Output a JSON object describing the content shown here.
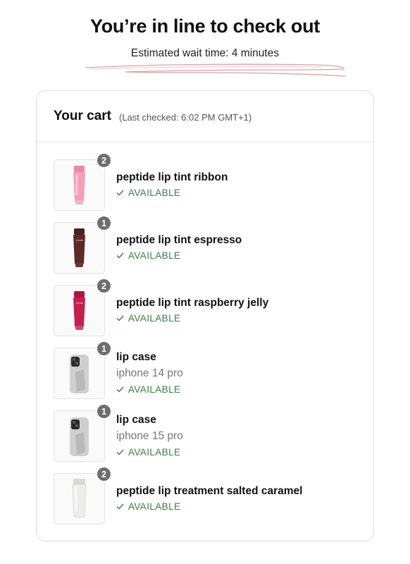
{
  "header": {
    "title": "You’re in line to check out",
    "wait_text": "Estimated wait time: 4 minutes"
  },
  "cart": {
    "title": "Your cart",
    "last_checked": "(Last checked: 6:02 PM GMT+1)",
    "items": [
      {
        "quantity": "2",
        "name": "peptide lip tint ribbon",
        "variant": "",
        "status": "AVAILABLE",
        "product_color": "#f2a0b6",
        "thumb_type": "tube-pink"
      },
      {
        "quantity": "1",
        "name": "peptide lip tint espresso",
        "variant": "",
        "status": "AVAILABLE",
        "product_color": "#5c2a28",
        "thumb_type": "tube-brown"
      },
      {
        "quantity": "2",
        "name": "peptide lip tint raspberry jelly",
        "variant": "",
        "status": "AVAILABLE",
        "product_color": "#c2204f",
        "thumb_type": "tube-raspberry"
      },
      {
        "quantity": "1",
        "name": "lip case",
        "variant": "iphone 14 pro",
        "status": "AVAILABLE",
        "product_color": "#c9c9c9",
        "thumb_type": "phone-case"
      },
      {
        "quantity": "1",
        "name": "lip case",
        "variant": "iphone 15 pro",
        "status": "AVAILABLE",
        "product_color": "#c9c9c9",
        "thumb_type": "phone-case"
      },
      {
        "quantity": "2",
        "name": "peptide lip treatment salted caramel",
        "variant": "",
        "status": "AVAILABLE",
        "product_color": "#e8e8e6",
        "thumb_type": "tube-clear"
      }
    ]
  },
  "colors": {
    "available_green": "#3e7a45",
    "badge_gray": "#6e6e6e",
    "scribble_pink": "#d58fa0"
  }
}
